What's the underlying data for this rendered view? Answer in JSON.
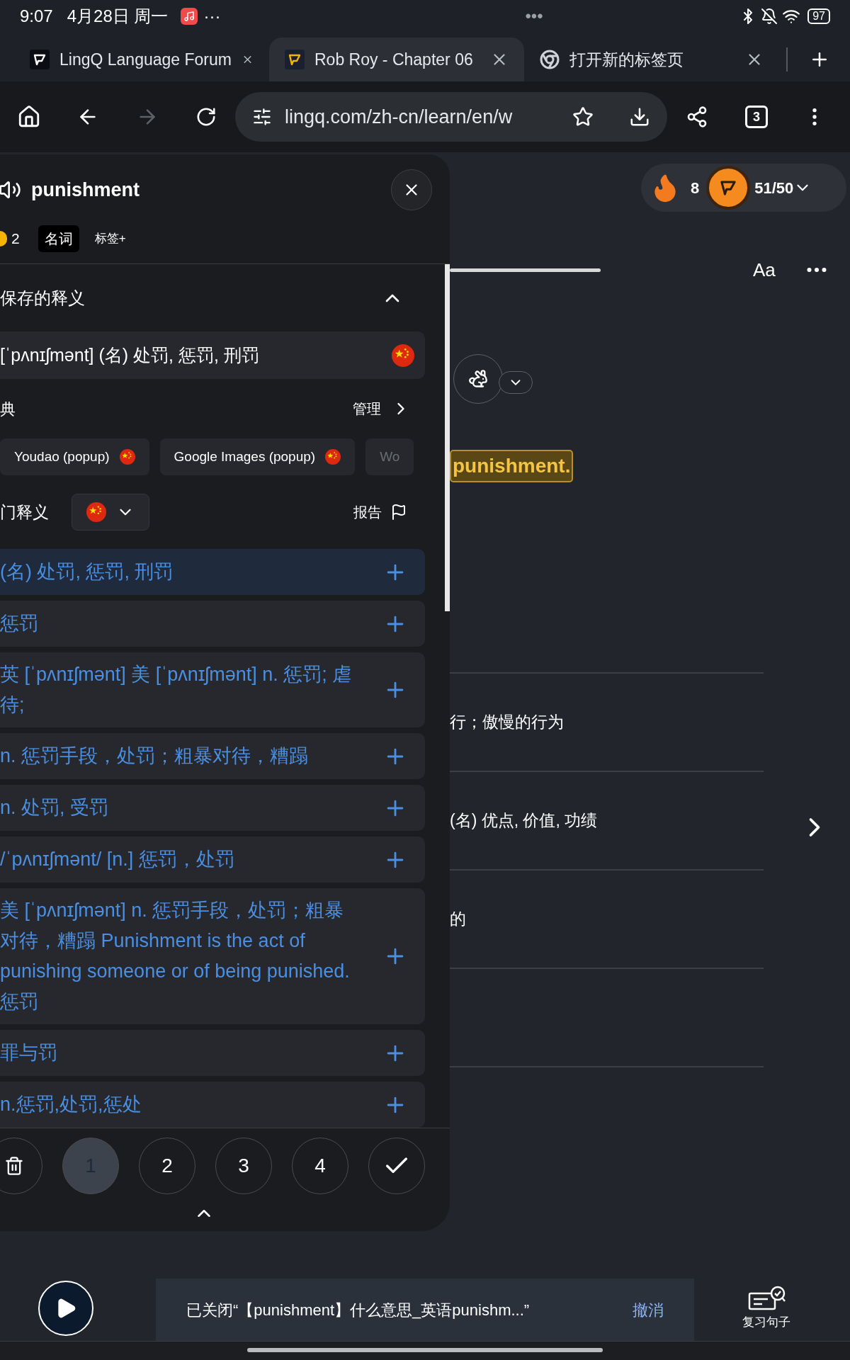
{
  "status_bar": {
    "time": "9:07",
    "date": "4月28日 周一",
    "more": "···",
    "center": "•••",
    "battery": "97"
  },
  "browser_tabs": [
    {
      "title": "LingQ Language Forum",
      "selected": false,
      "kind": "lingq-dark"
    },
    {
      "title": "Rob Roy - Chapter 06",
      "selected": true,
      "kind": "lingq"
    },
    {
      "title": "打开新的标签页",
      "selected": false,
      "kind": "chrome"
    }
  ],
  "address_bar": {
    "url": "lingq.com/zh-cn/learn/en/w",
    "tab_count": "3",
    "forward_disabled": true
  },
  "popup": {
    "word": "punishment",
    "coins": "2",
    "part_of_speech": "名词",
    "tag_button": "标签+",
    "saved_section": {
      "title": "保存的释义",
      "expanded": true
    },
    "saved_meaning": "[ˈpʌnɪʃmənt] (名)  处罚, 惩罚, 刑罚",
    "dictionary": {
      "title": "典",
      "manage": "管理"
    },
    "dictionaries": [
      {
        "name": "Youdao (popup)",
        "flag": true
      },
      {
        "name": "Google Images (popup)",
        "flag": true
      },
      {
        "name": "Wo",
        "flag": false
      }
    ],
    "popular": {
      "title": "门释义",
      "report": "报告"
    },
    "meanings": [
      {
        "text": "(名) 处罚, 惩罚, 刑罚",
        "selected": true
      },
      {
        "text": "惩罚",
        "selected": false
      },
      {
        "text": "英 [ˈpʌnɪʃmənt] 美 [ˈpʌnɪʃmənt] n. 惩罚; 虐待;",
        "selected": false
      },
      {
        "text": "n. 惩罚手段，处罚；粗暴对待，糟蹋",
        "selected": false
      },
      {
        "text": "n. 处罚, 受罚",
        "selected": false
      },
      {
        "text": "/ˈpʌnɪʃmənt/ [n.] 惩罚，处罚",
        "selected": false
      },
      {
        "text": "美 [ˈpʌnɪʃmənt] n. 惩罚手段，处罚；粗暴对待，糟蹋 Punishment is the act of punishing someone or of being punished. 惩罚",
        "selected": false
      },
      {
        "text": "罪与罚",
        "selected": false
      },
      {
        "text": "n.惩罚,处罚,惩处",
        "selected": false
      }
    ],
    "status_buttons": [
      {
        "label": "1",
        "selected": true
      },
      {
        "label": "2",
        "selected": false
      },
      {
        "label": "3",
        "selected": false
      },
      {
        "label": "4",
        "selected": false
      }
    ]
  },
  "reader": {
    "streak": "8",
    "lingqs": "51/50",
    "font_button": "Aa",
    "highlighted_word": "punishment.",
    "rows": [
      {
        "text": "行；傲慢的行为"
      },
      {
        "text": "(名) 优点, 价值, 功绩"
      },
      {
        "text": "的"
      }
    ]
  },
  "snackbar": {
    "message": "已关闭“【punishment】什么意思_英语punishm...”",
    "action": "撤消"
  },
  "review_button": "复习句子"
}
